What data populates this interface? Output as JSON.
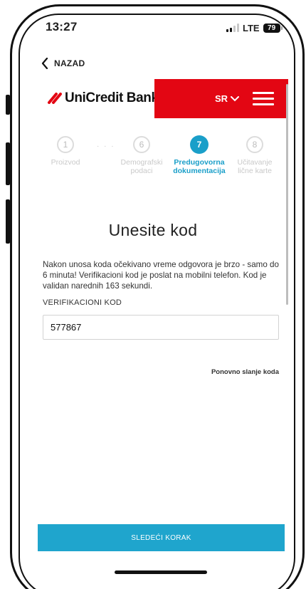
{
  "status_bar": {
    "time": "13:27",
    "network": "LTE",
    "battery": "79"
  },
  "nav": {
    "back_label": "NAZAD"
  },
  "header": {
    "logo_text": "UniCredit Bank",
    "language": "SR",
    "brand_color": "#e30613",
    "accent_color": "#1a9fc9"
  },
  "stepper": {
    "steps": [
      {
        "number": "1",
        "label": "Proizvod",
        "state": "inactive"
      },
      {
        "number": "6",
        "label": "Demografski podaci",
        "state": "inactive"
      },
      {
        "number": "7",
        "label": "Predugovorna dokumentacija",
        "state": "active"
      },
      {
        "number": "8",
        "label": "Učitavanje lične karte",
        "state": "inactive"
      }
    ],
    "ellipsis": "· · ·"
  },
  "main": {
    "title": "Unesite kod",
    "info_text": "Nakon unosa koda očekivano vreme odgovora je brzo - samo do 6 minuta! Verifikacioni kod je poslat na mobilni telefon. Kod je validan narednih 163 sekundi.",
    "code_label": "VERIFIKACIONI KOD",
    "code_value": "577867",
    "resend_label": "Ponovno slanje koda"
  },
  "footer": {
    "next_label": "SLEDEĆI KORAK"
  },
  "icons": {
    "back": "chevron-left-icon",
    "lang_dropdown": "chevron-down-icon",
    "menu": "hamburger-icon",
    "logo": "unicredit-logo-icon"
  }
}
